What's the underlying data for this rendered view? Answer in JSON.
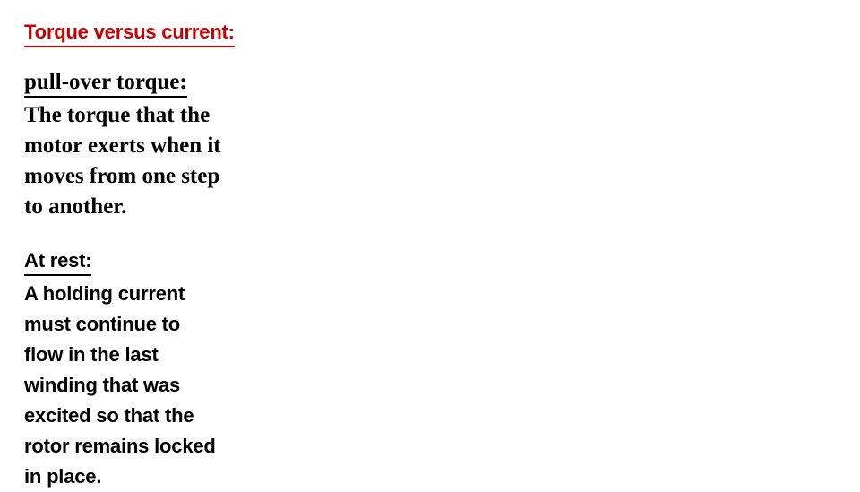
{
  "slide": {
    "background_color": "#FFFFFF",
    "title": {
      "text": "Torque versus current:",
      "color": "#CC0000",
      "underlined": true
    },
    "sections": [
      {
        "id": "pull-over-torque",
        "heading": "pull-over torque:",
        "heading_color": "#000000",
        "heading_underlined": true,
        "typeface": "serif",
        "lines": [
          "The torque that the",
          "motor exerts when it",
          "moves from one step",
          "to another."
        ]
      },
      {
        "id": "at-rest",
        "heading": "At rest:",
        "heading_color": "#000000",
        "heading_underlined": true,
        "typeface": "sans-serif",
        "lines": [
          "A holding current",
          "must continue to",
          "flow in the last",
          "winding that was",
          "excited so that the",
          "rotor remains locked",
          "in place."
        ]
      }
    ]
  }
}
